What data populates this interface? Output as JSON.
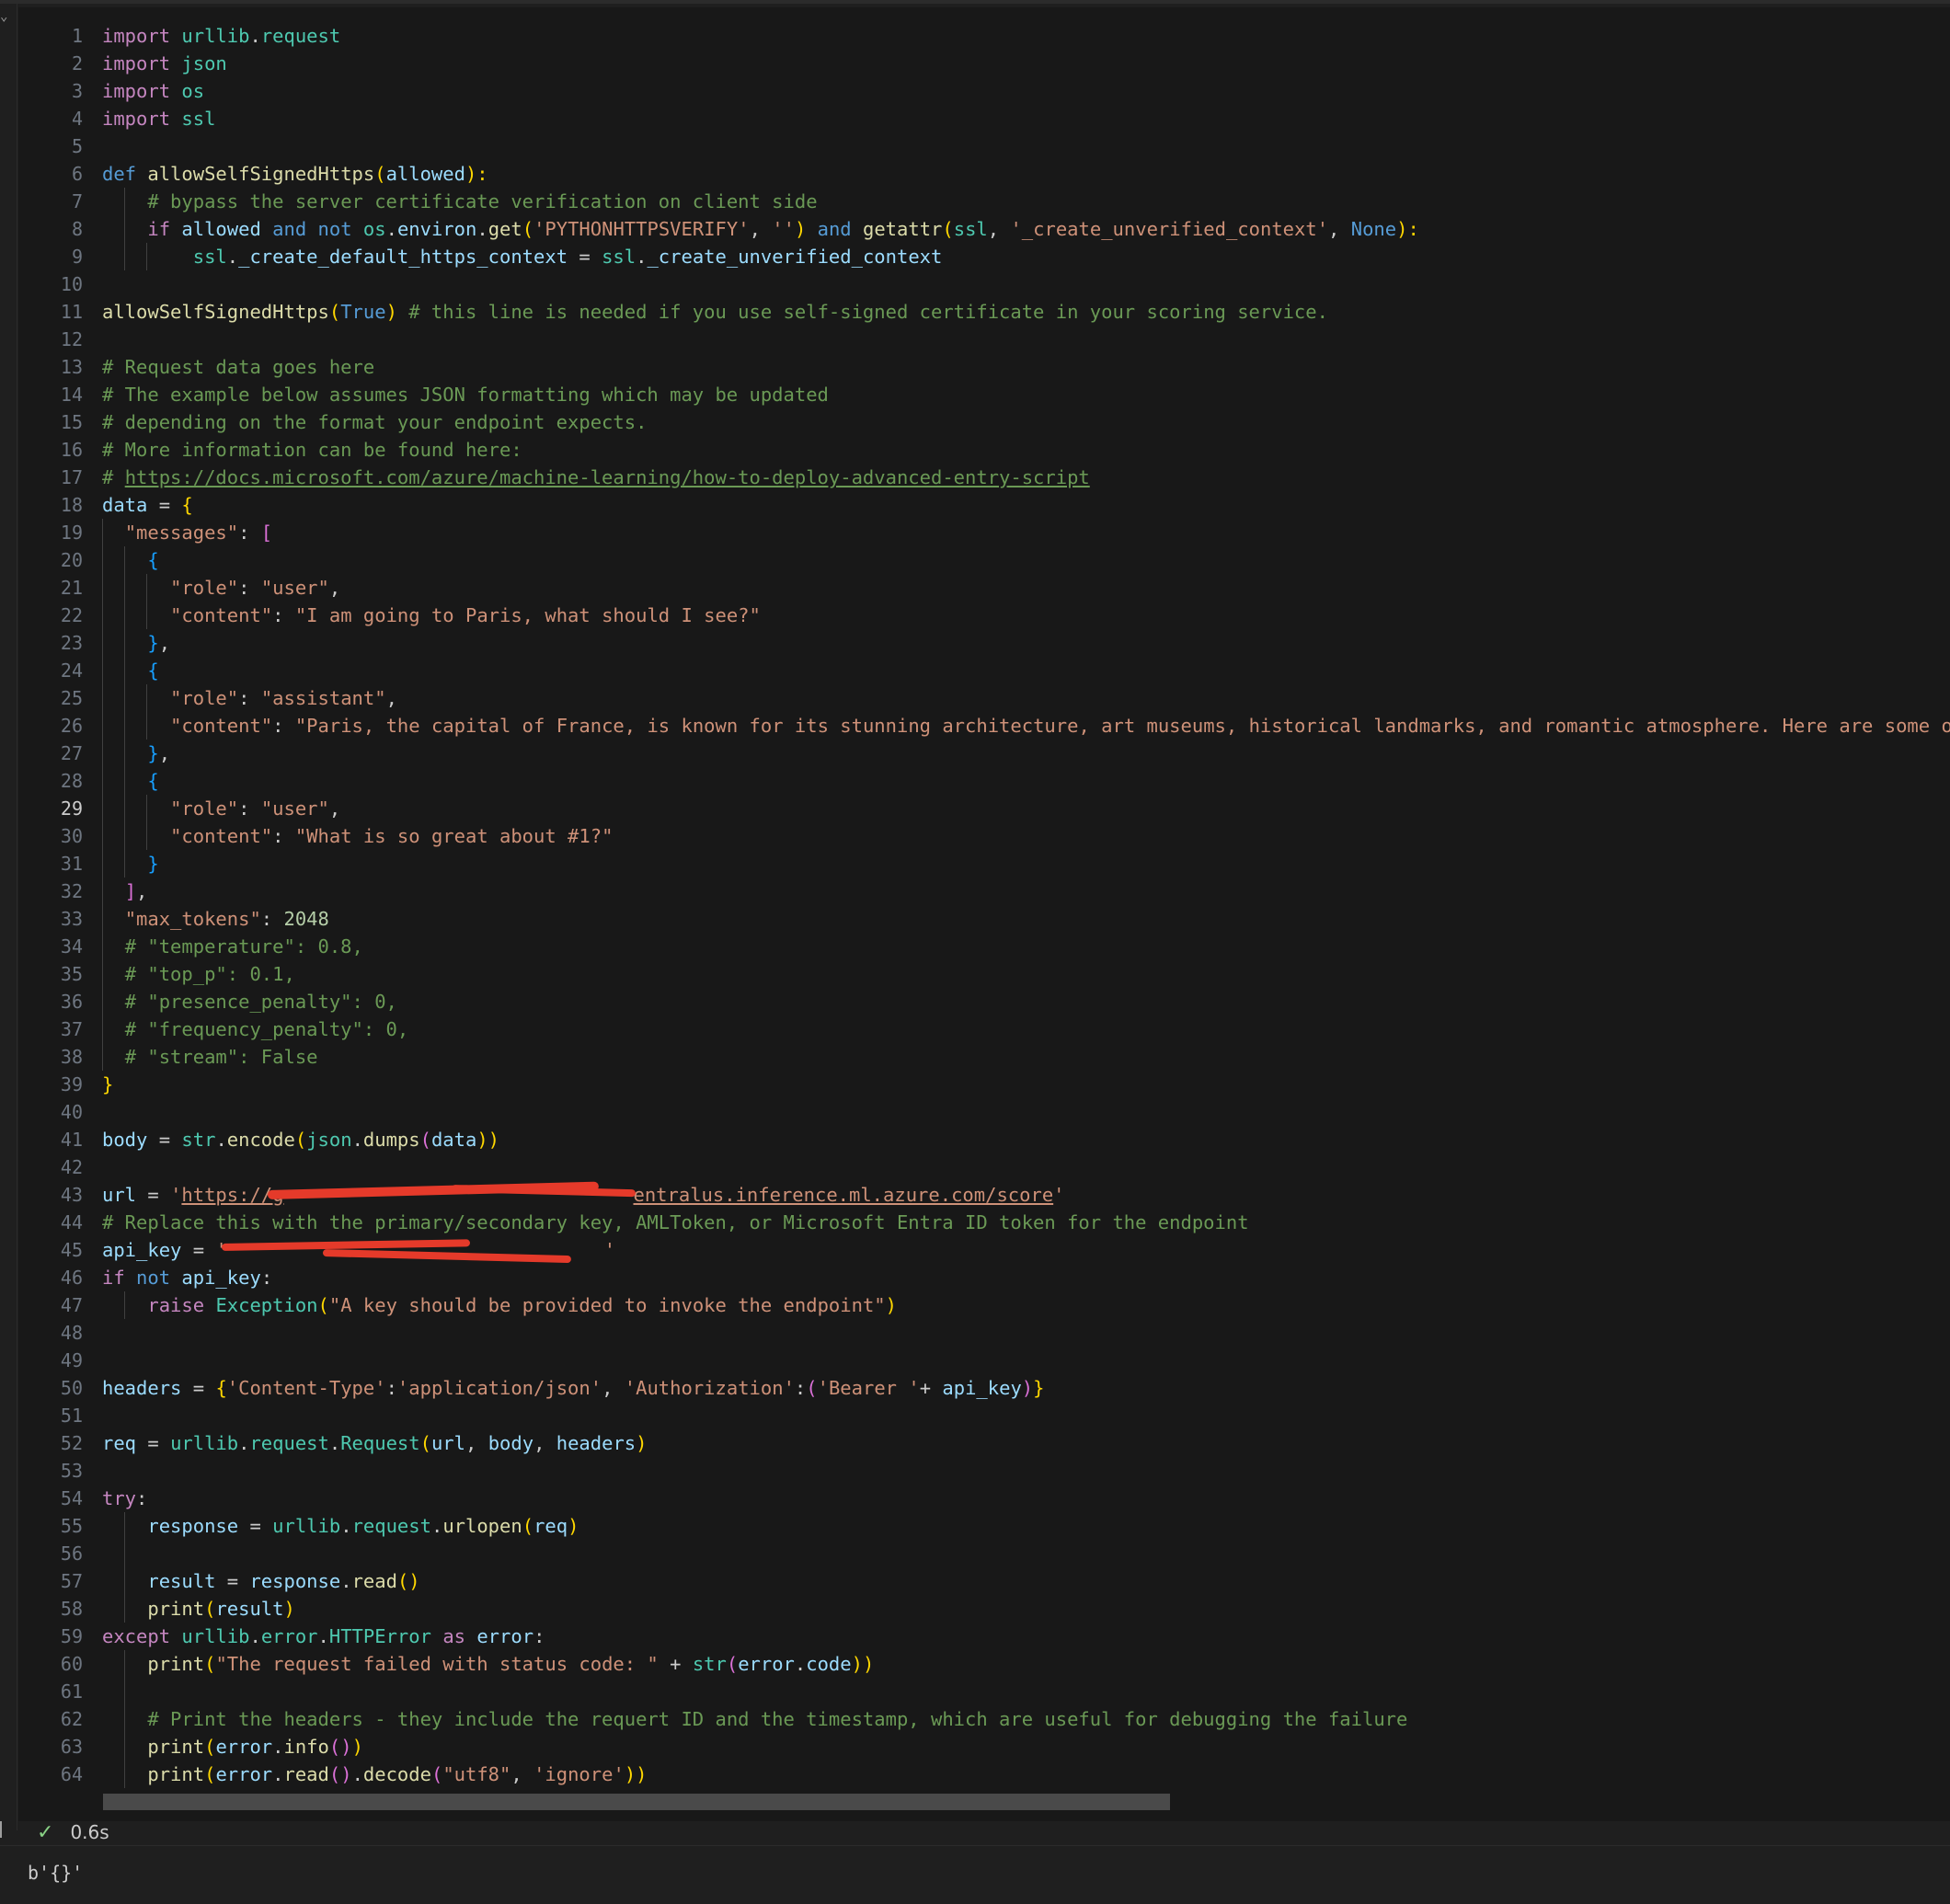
{
  "cell": {
    "line_numbers": [
      "1",
      "2",
      "3",
      "4",
      "5",
      "6",
      "7",
      "8",
      "9",
      "10",
      "11",
      "12",
      "13",
      "14",
      "15",
      "16",
      "17",
      "18",
      "19",
      "20",
      "21",
      "22",
      "23",
      "24",
      "25",
      "26",
      "27",
      "28",
      "29",
      "30",
      "31",
      "32",
      "33",
      "34",
      "35",
      "36",
      "37",
      "38",
      "39",
      "40",
      "41",
      "42",
      "43",
      "44",
      "45",
      "46",
      "47",
      "48",
      "49",
      "50",
      "51",
      "52",
      "53",
      "54",
      "55",
      "56",
      "57",
      "58",
      "59",
      "60",
      "61",
      "62",
      "63",
      "64"
    ],
    "active_line": "29",
    "tokens": {
      "l1": [
        "import",
        "urllib",
        ".",
        "request"
      ],
      "l2": [
        "import",
        "json"
      ],
      "l3": [
        "import",
        "os"
      ],
      "l4": [
        "import",
        "ssl"
      ],
      "l6": [
        "def",
        "allowSelfSignedHttps",
        "(",
        "allowed",
        "):"
      ],
      "l7": [
        "# bypass the server certificate verification on client side"
      ],
      "l8": [
        "if",
        "allowed",
        "and",
        "not",
        "os",
        ".",
        "environ",
        ".",
        "get",
        "(",
        "'PYTHONHTTPSVERIFY'",
        ", ",
        "''",
        ")",
        "and",
        "getattr",
        "(",
        "ssl",
        ", ",
        "'_create_unverified_context'",
        ", ",
        "None",
        "):"
      ],
      "l9": [
        "ssl",
        ".",
        "_create_default_https_context",
        " = ",
        "ssl",
        ".",
        "_create_unverified_context"
      ],
      "l11": [
        "allowSelfSignedHttps",
        "(",
        "True",
        ")",
        "# this line is needed if you use self-signed certificate in your scoring service."
      ],
      "l13": [
        "# Request data goes here"
      ],
      "l14": [
        "# The example below assumes JSON formatting which may be updated"
      ],
      "l15": [
        "# depending on the format your endpoint expects."
      ],
      "l16": [
        "# More information can be found here:"
      ],
      "l17": [
        "# ",
        "https://docs.microsoft.com/azure/machine-learning/how-to-deploy-advanced-entry-script"
      ],
      "l18": [
        "data",
        " = ",
        "{"
      ],
      "l19": [
        "\"messages\"",
        ": ",
        "["
      ],
      "l20": [
        "{"
      ],
      "l21": [
        "\"role\"",
        ": ",
        "\"user\"",
        ","
      ],
      "l22": [
        "\"content\"",
        ": ",
        "\"I am going to Paris, what should I see?\""
      ],
      "l23": [
        "}",
        ","
      ],
      "l24": [
        "{"
      ],
      "l25": [
        "\"role\"",
        ": ",
        "\"assistant\"",
        ","
      ],
      "l26": [
        "\"content\"",
        ": ",
        "\"Paris, the capital of France, is known for its stunning architecture, art museums, historical landmarks, and romantic atmosphere. Here are some of th"
      ],
      "l27": [
        "}",
        ","
      ],
      "l28": [
        "{"
      ],
      "l29": [
        "\"role\"",
        ": ",
        "\"user\"",
        ","
      ],
      "l30": [
        "\"content\"",
        ": ",
        "\"What is so great about #1?\""
      ],
      "l31": [
        "}"
      ],
      "l32": [
        "]",
        ","
      ],
      "l33": [
        "\"max_tokens\"",
        ": ",
        "2048"
      ],
      "l34": [
        "# \"temperature\": 0.8,"
      ],
      "l35": [
        "# \"top_p\": 0.1,"
      ],
      "l36": [
        "# \"presence_penalty\": 0,"
      ],
      "l37": [
        "# \"frequency_penalty\": 0,"
      ],
      "l38": [
        "# \"stream\": False"
      ],
      "l39": [
        "}"
      ],
      "l41": [
        "body",
        " = ",
        "str",
        ".",
        "encode",
        "(",
        "json",
        ".",
        "dumps",
        "(",
        "data",
        "))"
      ],
      "l43": [
        "url",
        " = ",
        "'",
        "https://g",
        "entralus.inference.ml.azure.com/score",
        "'"
      ],
      "l44": [
        "# Replace this with the primary/secondary key, AMLToken, or Microsoft Entra ID token for the endpoint"
      ],
      "l45": [
        "api_key",
        " = ",
        "'",
        "'"
      ],
      "l46": [
        "if",
        "not",
        "api_key",
        ":"
      ],
      "l47": [
        "raise",
        "Exception",
        "(",
        "\"A key should be provided to invoke the endpoint\"",
        ")"
      ],
      "l50": [
        "headers",
        " = ",
        "{",
        "'Content-Type'",
        ":",
        "'application/json'",
        ", ",
        "'Authorization'",
        ":",
        "(",
        "'Bearer '",
        "+ ",
        "api_key",
        ")",
        "}"
      ],
      "l52": [
        "req",
        " = ",
        "urllib",
        ".",
        "request",
        ".",
        "Request",
        "(",
        "url",
        ", ",
        "body",
        ", ",
        "headers",
        ")"
      ],
      "l54": [
        "try",
        ":"
      ],
      "l55": [
        "response",
        " = ",
        "urllib",
        ".",
        "request",
        ".",
        "urlopen",
        "(",
        "req",
        ")"
      ],
      "l57": [
        "result",
        " = ",
        "response",
        ".",
        "read",
        "()"
      ],
      "l58": [
        "print",
        "(",
        "result",
        ")"
      ],
      "l59": [
        "except",
        "urllib",
        ".",
        "error",
        ".",
        "HTTPError",
        "as",
        "error",
        ":"
      ],
      "l60": [
        "print",
        "(",
        "\"The request failed with status code: \"",
        " + ",
        "str",
        "(",
        "error",
        ".",
        "code",
        "))"
      ],
      "l62": [
        "# Print the headers - they include the requert ID and the timestamp, which are useful for debugging the failure"
      ],
      "l63": [
        "print",
        "(",
        "error",
        ".",
        "info",
        "()",
        ")"
      ],
      "l64": [
        "print",
        "(",
        "error",
        ".",
        "read",
        "()",
        ".",
        "decode",
        "(",
        "\"utf8\"",
        ", ",
        "'ignore'",
        "))"
      ]
    }
  },
  "status": {
    "check_icon": "check-icon",
    "elapsed": "0.6s"
  },
  "output": {
    "text": "b'{}'"
  },
  "colors": {
    "keyword": "#c586c0",
    "declaration": "#569cd6",
    "function": "#dcdcaa",
    "class": "#4ec9b0",
    "variable": "#9cdcfe",
    "string": "#ce9178",
    "comment": "#6a9955",
    "number": "#b5cea8",
    "success": "#89d185",
    "redaction": "#e53a2a"
  }
}
